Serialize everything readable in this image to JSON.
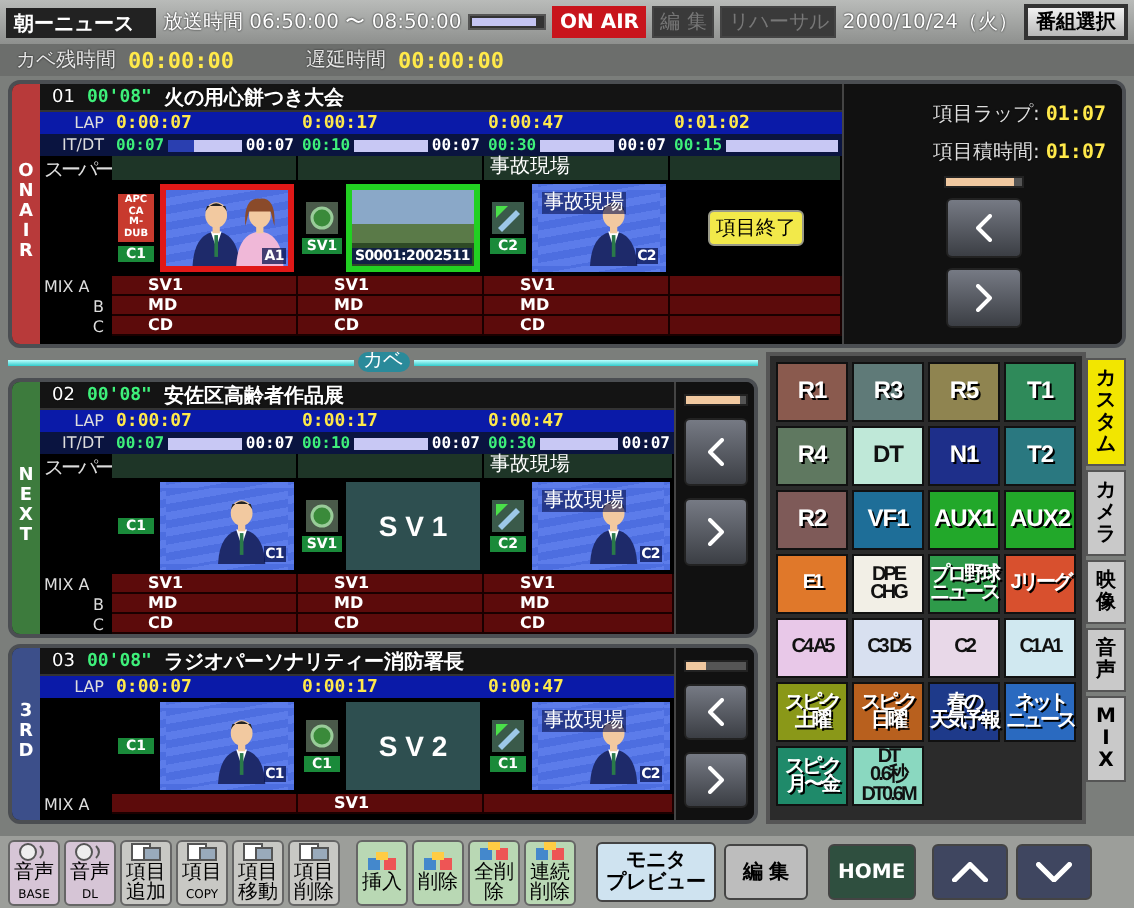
{
  "header": {
    "program": "朝ーニュース",
    "broadcast_time": "放送時間 06:50:00 〜 08:50:00",
    "progress": {
      "level": 0.9
    },
    "on_air": "ON AIR",
    "edit": {
      "label": "編 集",
      "disabled": true
    },
    "rehearsal": {
      "label": "リハーサル",
      "disabled": true
    },
    "date": "2000/10/24（火）",
    "program_select": "番組選択"
  },
  "timers": [
    {
      "label": "カベ残時間",
      "value": "00:00:00"
    },
    {
      "label": "遅延時間",
      "value": "00:00:00"
    }
  ],
  "items": [
    {
      "kind": "on_air",
      "slot_label": "ON AIR",
      "number": "01",
      "duration": "00'08\"",
      "title": "火の用心餅つき大会",
      "lap_label": "LAP",
      "itdt_label": "IT/DT",
      "super_label": "スーパー",
      "mix_labels": [
        "MIX A",
        "B",
        "C"
      ],
      "columns": [
        {
          "kind": "apc",
          "lap": "0:00:07",
          "it": "00:07",
          "dt": "00:07",
          "level": 0.65,
          "tag": "C1",
          "icon_lines": [
            "APC",
            "CA",
            "M-DUB"
          ],
          "thumb": {
            "kind": "people",
            "caption": "A1"
          },
          "on_air": true,
          "preview": false,
          "mix": [
            "SV1",
            "MD",
            "CD"
          ]
        },
        {
          "kind": "vtr",
          "lap": "0:00:17",
          "it": "00:10",
          "dt": "00:07",
          "level": 1,
          "tag": "SV1",
          "thumb": {
            "kind": "photo",
            "caption": "S0001:2002511"
          },
          "on_air": false,
          "preview": true,
          "mix": [
            "SV1",
            "MD",
            "CD"
          ]
        },
        {
          "kind": "graphic",
          "lap": "0:00:47",
          "it": "00:30",
          "dt": "00:07",
          "level": 1,
          "super": "事故現場",
          "tag": "C2",
          "thumb": {
            "kind": "person",
            "overlay": "事故現場",
            "caption": "C2"
          },
          "on_air": false,
          "preview": false,
          "mix": [
            "SV1",
            "MD",
            "CD"
          ]
        },
        {
          "kind": "end",
          "lap": "0:01:02",
          "it": "00:15",
          "level": 1,
          "action": "項目終了"
        }
      ],
      "side": {
        "lap_info": [
          {
            "label": "項目ラップ:",
            "value": "01:07"
          },
          {
            "label": "項目積時間:",
            "value": "01:07"
          }
        ],
        "meter": {
          "level": 0.9
        }
      }
    },
    {
      "kind": "next",
      "slot_label": "NEXT",
      "number": "02",
      "duration": "00'08\"",
      "title": "安佐区高齢者作品展",
      "lap_label": "LAP",
      "itdt_label": "IT/DT",
      "super_label": "スーパー",
      "mix_labels": [
        "MIX A",
        "B",
        "C"
      ],
      "columns": [
        {
          "kind": "camera",
          "lap": "0:00:07",
          "it": "00:07",
          "dt": "00:07",
          "level": 1,
          "tag": "C1",
          "thumb": {
            "kind": "person",
            "caption": "C1"
          },
          "on_air": false,
          "preview": false,
          "mix": [
            "SV1",
            "MD",
            "CD"
          ]
        },
        {
          "kind": "vtr",
          "lap": "0:00:17",
          "it": "00:10",
          "dt": "00:07",
          "level": 1,
          "tag": "SV1",
          "thumb": {
            "kind": "title",
            "text": "S V 1"
          },
          "on_air": false,
          "preview": false,
          "mix": [
            "SV1",
            "MD",
            "CD"
          ]
        },
        {
          "kind": "graphic",
          "lap": "0:00:47",
          "it": "00:30",
          "dt": "00:07",
          "level": 1,
          "super": "事故現場",
          "tag": "C2",
          "thumb": {
            "kind": "person",
            "overlay": "事故現場",
            "caption": "C2"
          },
          "on_air": false,
          "preview": false,
          "mix": [
            "SV1",
            "MD",
            "CD"
          ]
        }
      ],
      "side": {
        "meter": {
          "level": 0.9
        }
      }
    },
    {
      "kind": "third",
      "slot_label": "3RD",
      "number": "03",
      "duration": "00'08\"",
      "title": "ラジオパーソナリティー消防署長",
      "lap_label": "LAP",
      "mix_labels": [
        "MIX A"
      ],
      "columns": [
        {
          "kind": "camera",
          "lap": "0:00:07",
          "tag": "C1",
          "thumb": {
            "kind": "person",
            "caption": "C1"
          },
          "on_air": false,
          "preview": false
        },
        {
          "kind": "vtr",
          "lap": "0:00:17",
          "tag": "C1",
          "thumb": {
            "kind": "title",
            "text": "S V 2"
          },
          "on_air": false,
          "preview": false,
          "mix": [
            "SV1"
          ]
        },
        {
          "kind": "graphic",
          "lap": "0:00:47",
          "tag": "C1",
          "thumb": {
            "kind": "person",
            "overlay": "事故現場",
            "caption": "C2"
          },
          "on_air": false,
          "preview": false
        }
      ],
      "side": {
        "meter": {
          "level": 0.35
        }
      }
    }
  ],
  "wall_marker": "カベ",
  "palette": {
    "tiles": [
      {
        "kind": "code",
        "lines": [
          "R1"
        ],
        "color": "#8a5a4e"
      },
      {
        "kind": "code",
        "lines": [
          "R3"
        ],
        "color": "#5f7a78"
      },
      {
        "kind": "code",
        "lines": [
          "R5"
        ],
        "color": "#8f8450"
      },
      {
        "kind": "code",
        "lines": [
          "T1"
        ],
        "color": "#2f8a5a"
      },
      {
        "kind": "code",
        "lines": [
          "R4"
        ],
        "color": "#5f7860"
      },
      {
        "kind": "code",
        "lines": [
          "DT"
        ],
        "color": "#bfe8d8"
      },
      {
        "kind": "code",
        "lines": [
          "N1"
        ],
        "color": "#1e2f8a"
      },
      {
        "kind": "code",
        "lines": [
          "T2"
        ],
        "color": "#2a7880"
      },
      {
        "kind": "code",
        "lines": [
          "R2"
        ],
        "color": "#7e5a58"
      },
      {
        "kind": "code",
        "lines": [
          "VF1"
        ],
        "color": "#1e6e98"
      },
      {
        "kind": "code",
        "lines": [
          "AUX1"
        ],
        "color": "#22a82a"
      },
      {
        "kind": "code",
        "lines": [
          "AUX2"
        ],
        "color": "#22a82a"
      },
      {
        "kind": "label",
        "lines": [
          "E1"
        ],
        "color": "#e0782a"
      },
      {
        "kind": "label",
        "lines": [
          "DPE",
          "CHG"
        ],
        "color": "#f2efe6"
      },
      {
        "kind": "label",
        "lines": [
          "プロ野球",
          "ニュース"
        ],
        "color": "#2e9a4a"
      },
      {
        "kind": "label",
        "lines": [
          "Jリーグ"
        ],
        "color": "#d8502e"
      },
      {
        "kind": "label",
        "lines": [
          "C4 A5"
        ],
        "color": "#e8c8e8"
      },
      {
        "kind": "label",
        "lines": [
          "C3 D5"
        ],
        "color": "#d8e0f0"
      },
      {
        "kind": "label",
        "lines": [
          "C2"
        ],
        "color": "#e8d8e8"
      },
      {
        "kind": "label",
        "lines": [
          "C1 A1"
        ],
        "color": "#d0e8f0"
      },
      {
        "kind": "label",
        "lines": [
          "スピ-ク",
          "土曜"
        ],
        "color": "#8a9818"
      },
      {
        "kind": "label",
        "lines": [
          "スピ-ク",
          "日曜"
        ],
        "color": "#b8601e"
      },
      {
        "kind": "label",
        "lines": [
          "春の",
          "天気予報"
        ],
        "color": "#1e3a8a"
      },
      {
        "kind": "label",
        "lines": [
          "ネット",
          "ニュース"
        ],
        "color": "#2a6ac0"
      },
      {
        "kind": "label",
        "lines": [
          "スピ-ク",
          "月〜金"
        ],
        "color": "#1f8a6a"
      },
      {
        "kind": "label",
        "lines": [
          "DT",
          "0.6秒",
          "DT0.6M"
        ],
        "color": "#8ad8c0"
      }
    ],
    "tabs": [
      {
        "label": "カスタム",
        "selected": true
      },
      {
        "label": "カメラ",
        "selected": false
      },
      {
        "label": "映像",
        "selected": false
      },
      {
        "label": "音声",
        "selected": false
      },
      {
        "label": "MIX",
        "selected": false
      }
    ]
  },
  "toolbar": [
    {
      "kind": "audio",
      "label": "音声$_{BASE}$"
    },
    {
      "kind": "audio",
      "label": "音声$_{DL}$"
    },
    {
      "kind": "item",
      "label": "項目追加"
    },
    {
      "kind": "item",
      "label": "項目$_{COPY}$"
    },
    {
      "kind": "item",
      "label": "項目移動"
    },
    {
      "kind": "item",
      "label": "項目削除"
    },
    {
      "kind": "insert",
      "label": "挿入"
    },
    {
      "kind": "insert",
      "label": "削除"
    },
    {
      "kind": "insert",
      "label": "全削除"
    },
    {
      "kind": "insert",
      "label": "連続削除"
    },
    {
      "kind": "monitor",
      "lines": [
        "モニタ",
        "プレビュー"
      ]
    },
    {
      "kind": "edit",
      "label": "編 集"
    },
    {
      "kind": "home",
      "label": "HOME"
    },
    {
      "kind": "up"
    },
    {
      "kind": "down"
    }
  ]
}
